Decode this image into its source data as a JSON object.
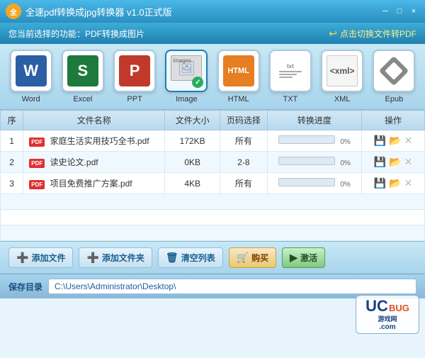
{
  "titleBar": {
    "logo": "全",
    "title": "全速pdf转换成jpg转换器 v1.0正式版",
    "minBtn": "─",
    "maxBtn": "□",
    "closeBtn": "×"
  },
  "subHeader": {
    "currentFunction": "您当前选择的功能：PDF转换成图片",
    "rightLink": "点击切换文件转PDF"
  },
  "toolbar": {
    "items": [
      {
        "id": "word",
        "label": "Word"
      },
      {
        "id": "excel",
        "label": "Excel"
      },
      {
        "id": "ppt",
        "label": "PPT"
      },
      {
        "id": "image",
        "label": "Image"
      },
      {
        "id": "html",
        "label": "HTML"
      },
      {
        "id": "txt",
        "label": "TXT"
      },
      {
        "id": "xml",
        "label": "XML"
      },
      {
        "id": "epub",
        "label": "Epub"
      }
    ]
  },
  "table": {
    "headers": [
      "序",
      "文件名称",
      "文件大小",
      "页码选择",
      "转换进度",
      "操作"
    ],
    "rows": [
      {
        "seq": "1",
        "name": "家庭生活实用技巧全书.pdf",
        "size": "172KB",
        "pages": "所有",
        "progress": "0%"
      },
      {
        "seq": "2",
        "name": "读史论文.pdf",
        "size": "0KB",
        "pages": "2-8",
        "progress": "0%"
      },
      {
        "seq": "3",
        "name": "项目免费推广方案.pdf",
        "size": "4KB",
        "pages": "所有",
        "progress": "0%"
      }
    ]
  },
  "bottomBar": {
    "addFile": "添加文件",
    "addFolder": "添加文件夹",
    "clearList": "清空列表",
    "buy": "购买",
    "activate": "激活"
  },
  "savePath": {
    "label": "保存目录",
    "path": "C:\\Users\\Administrator\\Desktop\\"
  },
  "watermark": {
    "uc": "UC",
    "bug": "BUG",
    "sub": "游戏网",
    "com": ".com"
  }
}
